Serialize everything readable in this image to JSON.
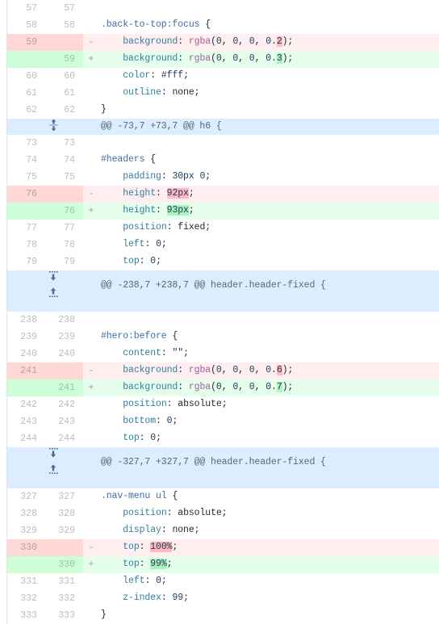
{
  "view": {
    "type": "unified-diff",
    "language": "css",
    "colors": {
      "deletion_line_bg": "#ffeef0",
      "deletion_gutter_bg": "#ffd7d5",
      "deletion_word_bg": "#fdb8c0",
      "addition_line_bg": "#e6ffed",
      "addition_gutter_bg": "#ccffd8",
      "addition_word_bg": "#acf2bd",
      "hunk_header_bg": "#dbedff",
      "context_bg": "#ffffff",
      "border": "#e1e4e8",
      "line_number_color": "#babec2"
    }
  },
  "rows": [
    {
      "type": "context",
      "old": "57",
      "new": "57",
      "marker": "",
      "code_html": ""
    },
    {
      "type": "context",
      "old": "58",
      "new": "58",
      "marker": "",
      "code_html": "<span class=\"tok-sel\">.back-to-top:focus</span> <span class=\"tok-punc\">{</span>"
    },
    {
      "type": "deletion",
      "old": "59",
      "new": "",
      "marker": "-",
      "code_html": "    <span class=\"tok-prop\">background</span><span class=\"tok-punc\">:</span> <span class=\"tok-func\">rgba</span><span class=\"tok-punc\">(</span><span class=\"tok-num\">0</span><span class=\"tok-punc\">,</span> <span class=\"tok-num\">0</span><span class=\"tok-punc\">,</span> <span class=\"tok-num\">0</span><span class=\"tok-punc\">,</span> <span class=\"tok-num\">0.</span><span class=\"wd-del tok-num\">2</span><span class=\"tok-punc\">);</span>"
    },
    {
      "type": "addition",
      "old": "",
      "new": "59",
      "marker": "+",
      "code_html": "    <span class=\"tok-prop\">background</span><span class=\"tok-punc\">:</span> <span class=\"tok-func\">rgba</span><span class=\"tok-punc\">(</span><span class=\"tok-num\">0</span><span class=\"tok-punc\">,</span> <span class=\"tok-num\">0</span><span class=\"tok-punc\">,</span> <span class=\"tok-num\">0</span><span class=\"tok-punc\">,</span> <span class=\"tok-num\">0.</span><span class=\"wd-add tok-num\">3</span><span class=\"tok-punc\">);</span>"
    },
    {
      "type": "context",
      "old": "60",
      "new": "60",
      "marker": "",
      "code_html": "    <span class=\"tok-prop\">color</span><span class=\"tok-punc\">:</span> <span class=\"tok-num\">#fff</span><span class=\"tok-punc\">;</span>"
    },
    {
      "type": "context",
      "old": "61",
      "new": "61",
      "marker": "",
      "code_html": "    <span class=\"tok-prop\">outline</span><span class=\"tok-punc\">:</span> <span class=\"tok-plain\">none</span><span class=\"tok-punc\">;</span>"
    },
    {
      "type": "context",
      "old": "62",
      "new": "62",
      "marker": "",
      "code_html": "<span class=\"tok-punc\">}</span>"
    },
    {
      "type": "hunk",
      "expander": "expand-both",
      "header": "@@ -73,7 +73,7 @@ h6 {"
    },
    {
      "type": "context",
      "old": "73",
      "new": "73",
      "marker": "",
      "code_html": ""
    },
    {
      "type": "context",
      "old": "74",
      "new": "74",
      "marker": "",
      "code_html": "<span class=\"tok-sel\">#headers</span> <span class=\"tok-punc\">{</span>"
    },
    {
      "type": "context",
      "old": "75",
      "new": "75",
      "marker": "",
      "code_html": "    <span class=\"tok-prop\">padding</span><span class=\"tok-punc\">:</span> <span class=\"tok-num\">30px</span> <span class=\"tok-num\">0</span><span class=\"tok-punc\">;</span>"
    },
    {
      "type": "deletion",
      "old": "76",
      "new": "",
      "marker": "-",
      "code_html": "    <span class=\"tok-prop\">height</span><span class=\"tok-punc\">:</span> <span class=\"wd-del tok-num\">92px</span><span class=\"tok-punc\">;</span>"
    },
    {
      "type": "addition",
      "old": "",
      "new": "76",
      "marker": "+",
      "code_html": "    <span class=\"tok-prop\">height</span><span class=\"tok-punc\">:</span> <span class=\"wd-add tok-num\">93px</span><span class=\"tok-punc\">;</span>"
    },
    {
      "type": "context",
      "old": "77",
      "new": "77",
      "marker": "",
      "code_html": "    <span class=\"tok-prop\">position</span><span class=\"tok-punc\">:</span> <span class=\"tok-plain\">fixed</span><span class=\"tok-punc\">;</span>"
    },
    {
      "type": "context",
      "old": "78",
      "new": "78",
      "marker": "",
      "code_html": "    <span class=\"tok-prop\">left</span><span class=\"tok-punc\">:</span> <span class=\"tok-num\">0</span><span class=\"tok-punc\">;</span>"
    },
    {
      "type": "context",
      "old": "79",
      "new": "79",
      "marker": "",
      "code_html": "    <span class=\"tok-prop\">top</span><span class=\"tok-punc\">:</span> <span class=\"tok-num\">0</span><span class=\"tok-punc\">;</span>"
    },
    {
      "type": "hunk",
      "expander": "expand-updown",
      "header": "@@ -238,7 +238,7 @@ header.header-fixed {"
    },
    {
      "type": "context",
      "old": "238",
      "new": "238",
      "marker": "",
      "code_html": ""
    },
    {
      "type": "context",
      "old": "239",
      "new": "239",
      "marker": "",
      "code_html": "<span class=\"tok-sel\">#hero:before</span> <span class=\"tok-punc\">{</span>"
    },
    {
      "type": "context",
      "old": "240",
      "new": "240",
      "marker": "",
      "code_html": "    <span class=\"tok-prop\">content</span><span class=\"tok-punc\">:</span> <span class=\"tok-str\">\"\"</span><span class=\"tok-punc\">;</span>"
    },
    {
      "type": "deletion",
      "old": "241",
      "new": "",
      "marker": "-",
      "code_html": "    <span class=\"tok-prop\">background</span><span class=\"tok-punc\">:</span> <span class=\"tok-func\">rgba</span><span class=\"tok-punc\">(</span><span class=\"tok-num\">0</span><span class=\"tok-punc\">,</span> <span class=\"tok-num\">0</span><span class=\"tok-punc\">,</span> <span class=\"tok-num\">0</span><span class=\"tok-punc\">,</span> <span class=\"tok-num\">0.</span><span class=\"wd-del tok-num\">6</span><span class=\"tok-punc\">);</span>"
    },
    {
      "type": "addition",
      "old": "",
      "new": "241",
      "marker": "+",
      "code_html": "    <span class=\"tok-prop\">background</span><span class=\"tok-punc\">:</span> <span class=\"tok-func\">rgba</span><span class=\"tok-punc\">(</span><span class=\"tok-num\">0</span><span class=\"tok-punc\">,</span> <span class=\"tok-num\">0</span><span class=\"tok-punc\">,</span> <span class=\"tok-num\">0</span><span class=\"tok-punc\">,</span> <span class=\"tok-num\">0.</span><span class=\"wd-add tok-num\">7</span><span class=\"tok-punc\">);</span>"
    },
    {
      "type": "context",
      "old": "242",
      "new": "242",
      "marker": "",
      "code_html": "    <span class=\"tok-prop\">position</span><span class=\"tok-punc\">:</span> <span class=\"tok-plain\">absolute</span><span class=\"tok-punc\">;</span>"
    },
    {
      "type": "context",
      "old": "243",
      "new": "243",
      "marker": "",
      "code_html": "    <span class=\"tok-prop\">bottom</span><span class=\"tok-punc\">:</span> <span class=\"tok-num\">0</span><span class=\"tok-punc\">;</span>"
    },
    {
      "type": "context",
      "old": "244",
      "new": "244",
      "marker": "",
      "code_html": "    <span class=\"tok-prop\">top</span><span class=\"tok-punc\">:</span> <span class=\"tok-num\">0</span><span class=\"tok-punc\">;</span>"
    },
    {
      "type": "hunk",
      "expander": "expand-updown",
      "header": "@@ -327,7 +327,7 @@ header.header-fixed {"
    },
    {
      "type": "context",
      "old": "327",
      "new": "327",
      "marker": "",
      "code_html": "<span class=\"tok-sel\">.nav-menu ul</span> <span class=\"tok-punc\">{</span>"
    },
    {
      "type": "context",
      "old": "328",
      "new": "328",
      "marker": "",
      "code_html": "    <span class=\"tok-prop\">position</span><span class=\"tok-punc\">:</span> <span class=\"tok-plain\">absolute</span><span class=\"tok-punc\">;</span>"
    },
    {
      "type": "context",
      "old": "329",
      "new": "329",
      "marker": "",
      "code_html": "    <span class=\"tok-prop\">display</span><span class=\"tok-punc\">:</span> <span class=\"tok-plain\">none</span><span class=\"tok-punc\">;</span>"
    },
    {
      "type": "deletion",
      "old": "330",
      "new": "",
      "marker": "-",
      "code_html": "    <span class=\"tok-prop\">top</span><span class=\"tok-punc\">:</span> <span class=\"wd-del tok-num\">100%</span><span class=\"tok-punc\">;</span>"
    },
    {
      "type": "addition",
      "old": "",
      "new": "330",
      "marker": "+",
      "code_html": "    <span class=\"tok-prop\">top</span><span class=\"tok-punc\">:</span> <span class=\"wd-add tok-num\">99%</span><span class=\"tok-punc\">;</span>"
    },
    {
      "type": "context",
      "old": "331",
      "new": "331",
      "marker": "",
      "code_html": "    <span class=\"tok-prop\">left</span><span class=\"tok-punc\">:</span> <span class=\"tok-num\">0</span><span class=\"tok-punc\">;</span>"
    },
    {
      "type": "context",
      "old": "332",
      "new": "332",
      "marker": "",
      "code_html": "    <span class=\"tok-prop\">z-index</span><span class=\"tok-punc\">:</span> <span class=\"tok-num\">99</span><span class=\"tok-punc\">;</span>"
    },
    {
      "type": "context",
      "old": "333",
      "new": "333",
      "marker": "",
      "code_html": "<span class=\"tok-punc\">}</span>"
    }
  ]
}
